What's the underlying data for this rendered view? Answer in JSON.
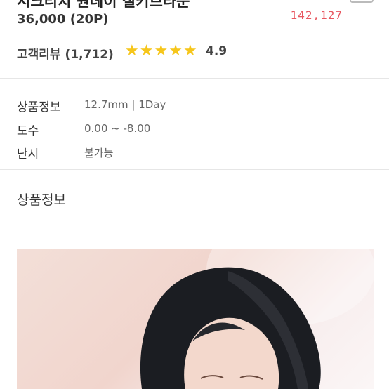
{
  "product": {
    "title": "시크리치 원데이 실키브라운",
    "price": "36,000 (20P)",
    "counter": "142,127"
  },
  "reviews": {
    "label": "고객리뷰 (1,712)",
    "rating": "4.9",
    "rating_value": 4.9,
    "rating_max": 5,
    "star_char": "★",
    "star_color": "#f6c61b"
  },
  "specs": [
    {
      "label": "상품정보",
      "value": "12.7mm | 1Day"
    },
    {
      "label": "도수",
      "value": "0.00 ~ -8.00"
    },
    {
      "label": "난시",
      "value": "불가능"
    }
  ],
  "section": {
    "title": "상품정보"
  },
  "colors": {
    "counter": "#e8565f",
    "text": "#222222"
  }
}
